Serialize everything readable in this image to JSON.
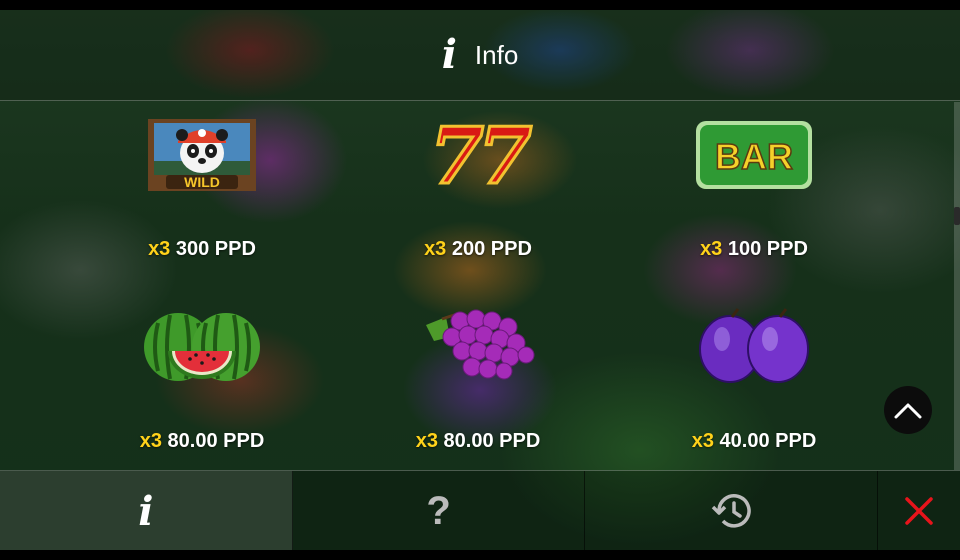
{
  "header": {
    "title": "Info",
    "icon": "info-icon"
  },
  "paytable": [
    {
      "symbol": "wild-panda-icon",
      "symbol_text": "WILD",
      "multiplier": "x3",
      "amount": "300 PPD"
    },
    {
      "symbol": "seven-seven-icon",
      "symbol_text": "77",
      "multiplier": "x3",
      "amount": "200 PPD"
    },
    {
      "symbol": "bar-icon",
      "symbol_text": "BAR",
      "multiplier": "x3",
      "amount": "100 PPD"
    },
    {
      "symbol": "watermelon-icon",
      "multiplier": "x3",
      "amount": "80.00 PPD"
    },
    {
      "symbol": "grapes-icon",
      "multiplier": "x3",
      "amount": "80.00 PPD"
    },
    {
      "symbol": "plum-icon",
      "multiplier": "x3",
      "amount": "40.00 PPD"
    }
  ],
  "bottom_tabs": [
    {
      "name": "info",
      "icon": "info-icon",
      "label": "i",
      "active": true
    },
    {
      "name": "help",
      "icon": "question-mark-icon",
      "label": "?"
    },
    {
      "name": "history",
      "icon": "history-icon"
    },
    {
      "name": "close",
      "icon": "close-icon"
    }
  ],
  "colors": {
    "multiplier": "#ffd21a",
    "close": "#e8141b"
  }
}
